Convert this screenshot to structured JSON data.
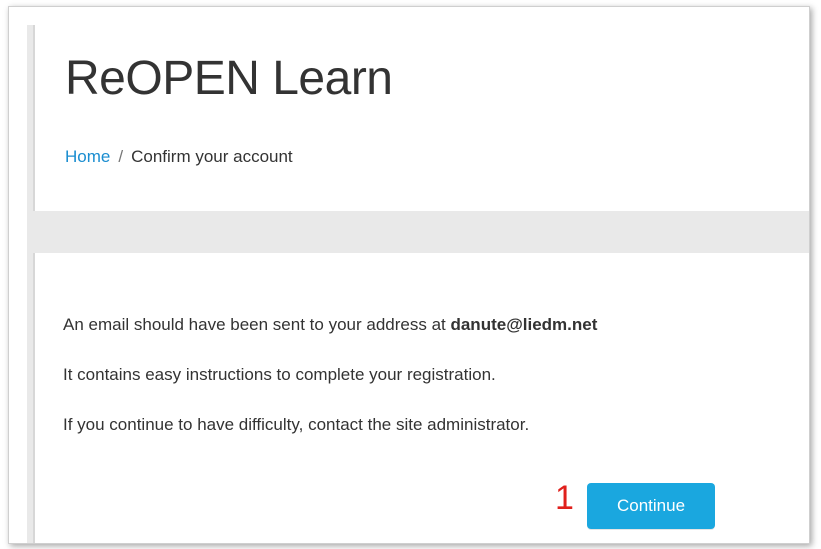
{
  "header": {
    "site_title": "ReOPEN Learn",
    "breadcrumb": {
      "home_label": "Home",
      "separator": "/",
      "current_label": "Confirm your account"
    }
  },
  "main": {
    "message_prefix": "An email should have been sent to your address at ",
    "email": "danute@liedm.net",
    "instructions": "It contains easy instructions to complete your registration.",
    "difficulty": "If you continue to have difficulty, contact the site administrator.",
    "continue_label": "Continue"
  },
  "annotation": {
    "step_number": "1"
  },
  "colors": {
    "link": "#1a8dd0",
    "button": "#1aa7df",
    "annotation": "#e0201c"
  }
}
